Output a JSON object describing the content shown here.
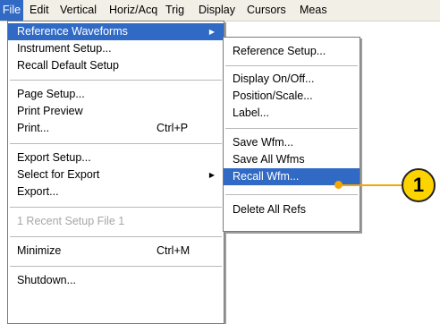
{
  "menubar": {
    "items": [
      "File",
      "Edit",
      "Vertical",
      "Horiz/Acq",
      "Trig",
      "Display",
      "Cursors",
      "Meas"
    ]
  },
  "file_menu": {
    "items": [
      {
        "label": "Reference Waveforms",
        "shortcut": "",
        "submenu": true,
        "selected": true
      },
      {
        "label": "Instrument Setup...",
        "shortcut": ""
      },
      {
        "label": "Recall Default Setup",
        "shortcut": ""
      },
      {
        "label": "Page Setup...",
        "shortcut": ""
      },
      {
        "label": "Print Preview",
        "shortcut": ""
      },
      {
        "label": "Print...",
        "shortcut": "Ctrl+P"
      },
      {
        "label": "Export Setup...",
        "shortcut": ""
      },
      {
        "label": "Select for Export",
        "shortcut": "",
        "submenu": true
      },
      {
        "label": "Export...",
        "shortcut": ""
      },
      {
        "label": "1 Recent Setup File 1",
        "shortcut": "",
        "disabled": true
      },
      {
        "label": "Minimize",
        "shortcut": "Ctrl+M"
      },
      {
        "label": "Shutdown...",
        "shortcut": ""
      }
    ]
  },
  "ref_submenu": {
    "items": [
      {
        "label": "Reference Setup..."
      },
      {
        "label": "Display On/Off..."
      },
      {
        "label": "Position/Scale..."
      },
      {
        "label": "Label..."
      },
      {
        "label": "Save Wfm..."
      },
      {
        "label": "Save All Wfms"
      },
      {
        "label": "Recall Wfm...",
        "selected": true
      },
      {
        "label": "Delete All Refs"
      }
    ]
  },
  "callout": {
    "number": "1"
  },
  "colors": {
    "highlight": "#316ac5",
    "callout_fill": "#fdd300",
    "callout_line": "#f6a600"
  }
}
